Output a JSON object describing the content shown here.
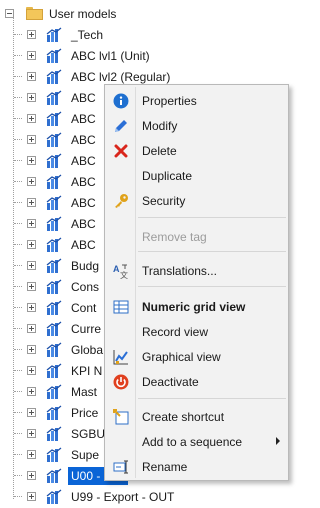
{
  "tree": {
    "root_label": "User models",
    "items": [
      "_Tech",
      "ABC lvl1 (Unit)",
      "ABC lvl2 (Regular)",
      "ABC",
      "ABC",
      "ABC",
      "ABC",
      "ABC",
      "ABC",
      "ABC",
      "ABC",
      "Budg",
      "Cons",
      "Cont",
      "Curre",
      "Globa",
      "KPI N",
      "Mast",
      "Price",
      "SGBU",
      "Supe",
      "U00 -",
      "U99 - Export - OUT"
    ],
    "selected_index": 21
  },
  "context_menu": {
    "properties": "Properties",
    "modify": "Modify",
    "delete": "Delete",
    "duplicate": "Duplicate",
    "security": "Security",
    "remove_tag": "Remove tag",
    "translations": "Translations...",
    "numeric_grid_view": "Numeric grid view",
    "record_view": "Record view",
    "graphical_view": "Graphical view",
    "deactivate": "Deactivate",
    "create_shortcut": "Create shortcut",
    "add_to_sequence": "Add to a sequence",
    "rename": "Rename"
  },
  "colors": {
    "selection": "#0a64d6",
    "info_blue": "#1e6fd0",
    "delete_red": "#d9261c",
    "deactivate_red": "#e0401f",
    "security_gold": "#e0a21a"
  }
}
